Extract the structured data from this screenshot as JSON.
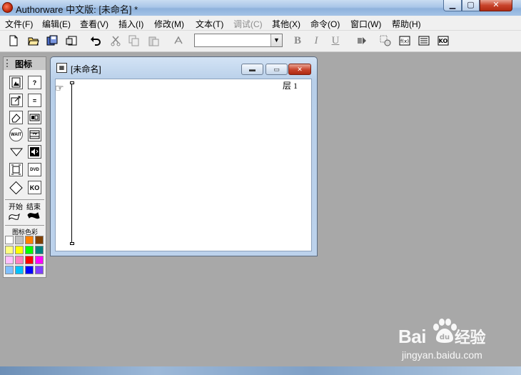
{
  "window": {
    "title": "Authorware 中文版: [未命名] *"
  },
  "menu": [
    {
      "label": "文件(F)",
      "disabled": false
    },
    {
      "label": "编辑(E)",
      "disabled": false
    },
    {
      "label": "查看(V)",
      "disabled": false
    },
    {
      "label": "插入(I)",
      "disabled": false
    },
    {
      "label": "修改(M)",
      "disabled": false
    },
    {
      "label": "文本(T)",
      "disabled": false
    },
    {
      "label": "调试(C)",
      "disabled": true
    },
    {
      "label": "其他(X)",
      "disabled": false
    },
    {
      "label": "命令(O)",
      "disabled": false
    },
    {
      "label": "窗口(W)",
      "disabled": false
    },
    {
      "label": "帮助(H)",
      "disabled": false
    }
  ],
  "toolbar": {
    "icons": [
      "new-file-icon",
      "open-file-icon",
      "save-all-icon",
      "import-icon",
      "undo-icon",
      "cut-icon",
      "copy-icon",
      "paste-icon",
      "find-icon"
    ],
    "style_combo_value": "",
    "bold_label": "B",
    "italic_label": "I",
    "underline_label": "U",
    "right_icons": [
      "run-icon",
      "control-panel-icon",
      "functions-icon",
      "variables-icon",
      "knowledge-objects-icon"
    ]
  },
  "palette": {
    "title": "图标",
    "icons": [
      {
        "name": "display-icon",
        "glyph": ""
      },
      {
        "name": "interaction-icon",
        "glyph": "?"
      },
      {
        "name": "motion-icon",
        "glyph": ""
      },
      {
        "name": "calculation-icon",
        "glyph": "="
      },
      {
        "name": "erase-icon",
        "glyph": ""
      },
      {
        "name": "map-icon",
        "glyph": ""
      },
      {
        "name": "wait-icon",
        "glyph": "WAIT"
      },
      {
        "name": "digital-movie-icon",
        "glyph": ""
      },
      {
        "name": "navigate-icon",
        "glyph": ""
      },
      {
        "name": "sound-icon",
        "glyph": ""
      },
      {
        "name": "framework-icon",
        "glyph": ""
      },
      {
        "name": "dvd-icon",
        "glyph": "DVD"
      },
      {
        "name": "decision-icon",
        "glyph": ""
      },
      {
        "name": "knowledge-object-icon",
        "glyph": "KO"
      }
    ],
    "start_label": "开始",
    "end_label": "结束",
    "color_label": "图标色彩",
    "colors": [
      "#ffffff",
      "#c0c0c0",
      "#ff8000",
      "#804000",
      "#ffff80",
      "#ffff00",
      "#00ff00",
      "#008080",
      "#ffc0ff",
      "#ff80c0",
      "#ff0000",
      "#ff00ff",
      "#80c0ff",
      "#00c0ff",
      "#0000ff",
      "#8040ff"
    ]
  },
  "design_window": {
    "title": "[未命名]",
    "layer_label": "层 1"
  },
  "watermark": {
    "logo_left": "Bai",
    "logo_right": "经验",
    "url": "jingyan.baidu.com"
  }
}
